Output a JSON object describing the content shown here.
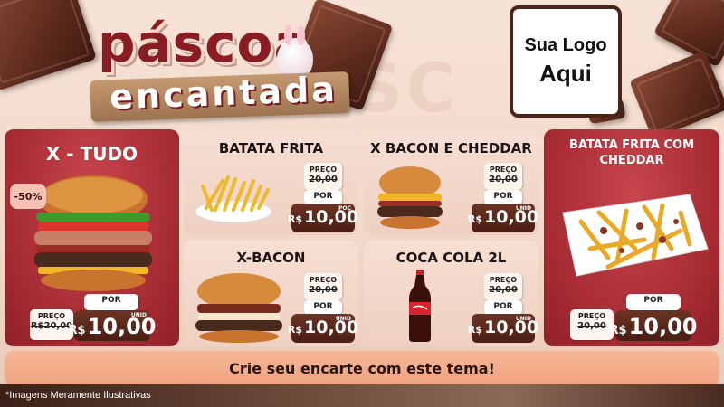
{
  "brand": {
    "title_line1": "páscoa",
    "title_line2": "encantada",
    "logo_line1": "Sua Logo",
    "logo_line2": "Aqui"
  },
  "products": [
    {
      "name": "X - TUDO",
      "badge": "-50%",
      "preco_label": "PREÇO",
      "old_price": "R$20,00",
      "por_label": "POR",
      "currency": "R$",
      "price": "10,00",
      "unit": "UNID"
    },
    {
      "name": "BATATA FRITA",
      "preco_label": "PREÇO",
      "old_price": "20,00",
      "por_label": "POR",
      "currency": "R$",
      "price": "10,00",
      "unit": "POÇ"
    },
    {
      "name": "X BACON E CHEDDAR",
      "preco_label": "PREÇO",
      "old_price": "20,00",
      "por_label": "POR",
      "currency": "R$",
      "price": "10,00",
      "unit": "UNID"
    },
    {
      "name": "BATATA FRITA COM CHEDDAR",
      "preco_label": "PREÇO",
      "old_price": "20,00",
      "por_label": "POR",
      "currency": "R$",
      "price": "10,00",
      "unit": ""
    },
    {
      "name": "X-BACON",
      "preco_label": "PREÇO",
      "old_price": "20,00",
      "por_label": "POR",
      "currency": "R$",
      "price": "10,00",
      "unit": "UNID"
    },
    {
      "name": "COCA COLA 2L",
      "preco_label": "PREÇO",
      "old_price": "20,00",
      "por_label": "POR",
      "currency": "R$",
      "price": "10,00",
      "unit": "UNID"
    }
  ],
  "banner": "Crie seu encarte com este tema!",
  "disclaimer": "*Imagens Meramente Ilustrativas",
  "colors": {
    "accent_red": "#a52a32",
    "chocolate": "#4a1f14",
    "banner": "#f0a280"
  }
}
